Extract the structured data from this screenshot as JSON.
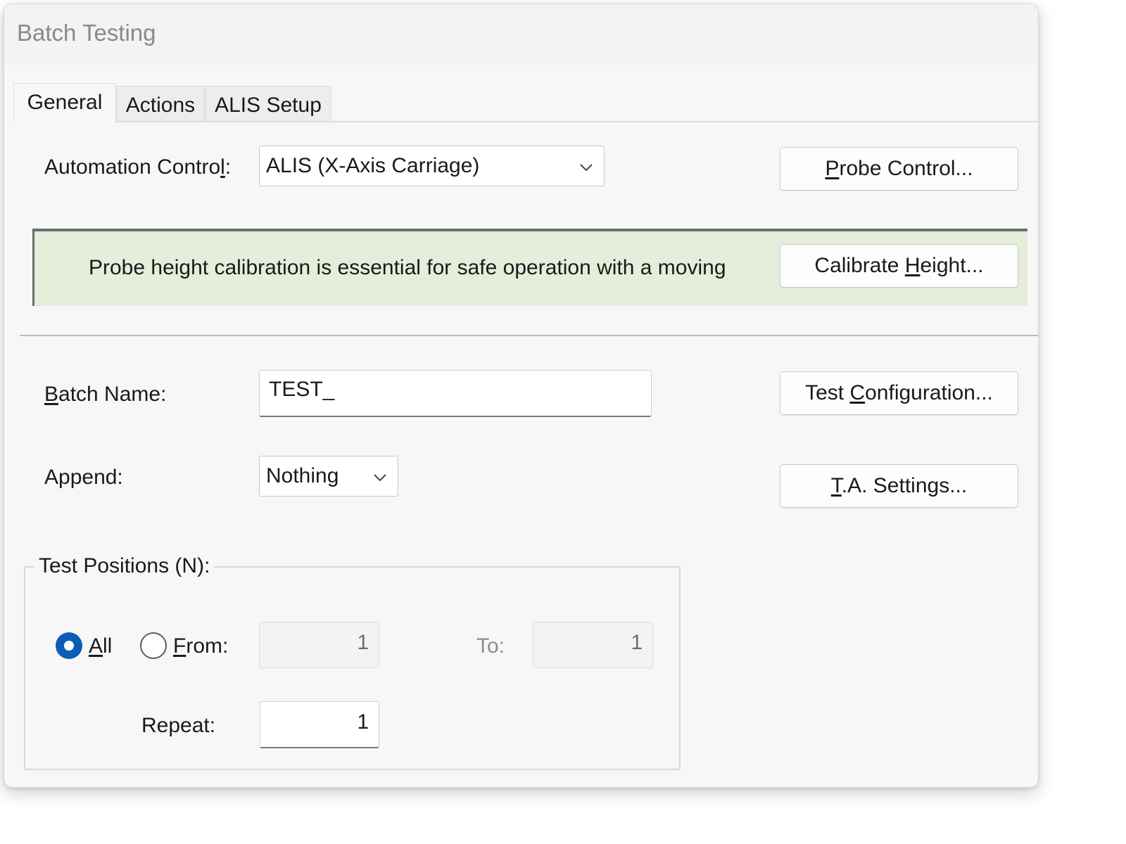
{
  "window": {
    "title": "Batch Testing"
  },
  "tabs": [
    {
      "label": "General"
    },
    {
      "label": "Actions"
    },
    {
      "label": "ALIS Setup"
    }
  ],
  "general": {
    "automation_control": {
      "label_pre": "Automation Contro",
      "label_key": "l",
      "label_post": ":",
      "value": "ALIS (X-Axis Carriage)"
    },
    "probe_control_button": {
      "key": "P",
      "rest": "robe Control..."
    },
    "banner": {
      "text": "Probe height calibration is essential for safe operation with a moving",
      "background": "#e5eddb"
    },
    "calibrate_button": {
      "pre": "Calibrate ",
      "key": "H",
      "rest": "eight..."
    },
    "batch_name": {
      "label_key": "B",
      "label_rest": "atch Name:",
      "value": "TEST_"
    },
    "test_config_button": {
      "pre": "Test ",
      "key": "C",
      "rest": "onfiguration..."
    },
    "append": {
      "label": "Append:",
      "value": "Nothing"
    },
    "ta_settings_button": {
      "key": "T",
      "rest": ".A. Settings..."
    },
    "test_positions": {
      "legend": "Test Positions (N):",
      "all": {
        "key": "A",
        "rest": "ll",
        "selected": true
      },
      "from": {
        "key": "F",
        "rest": "rom:",
        "selected": false,
        "value": "1"
      },
      "to": {
        "label": "To:",
        "value": "1"
      },
      "repeat": {
        "label": "Repeat:",
        "value": "1"
      }
    }
  },
  "colors": {
    "accent": "#0a5fb4",
    "window_bg": "#f7f7f7"
  }
}
